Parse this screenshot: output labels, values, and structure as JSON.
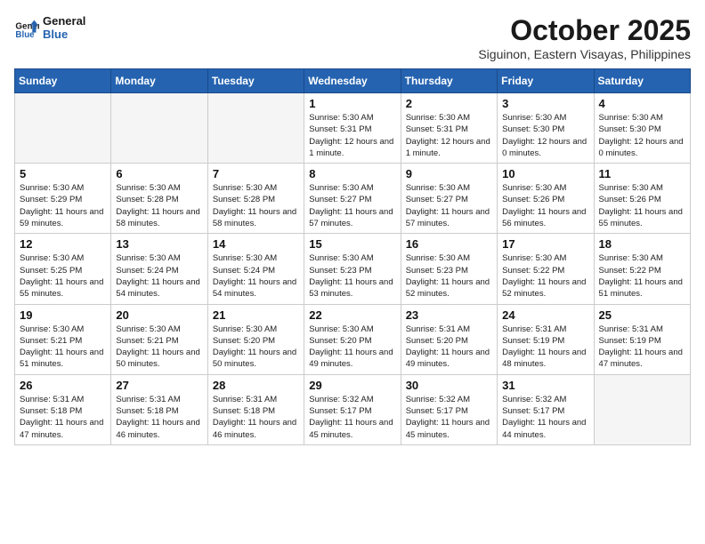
{
  "header": {
    "logo_line1": "General",
    "logo_line2": "Blue",
    "month": "October 2025",
    "location": "Siguinon, Eastern Visayas, Philippines"
  },
  "days_of_week": [
    "Sunday",
    "Monday",
    "Tuesday",
    "Wednesday",
    "Thursday",
    "Friday",
    "Saturday"
  ],
  "weeks": [
    [
      {
        "day": "",
        "empty": true
      },
      {
        "day": "",
        "empty": true
      },
      {
        "day": "",
        "empty": true
      },
      {
        "day": "1",
        "sunrise": "5:30 AM",
        "sunset": "5:31 PM",
        "daylight": "12 hours and 1 minute."
      },
      {
        "day": "2",
        "sunrise": "5:30 AM",
        "sunset": "5:31 PM",
        "daylight": "12 hours and 1 minute."
      },
      {
        "day": "3",
        "sunrise": "5:30 AM",
        "sunset": "5:30 PM",
        "daylight": "12 hours and 0 minutes."
      },
      {
        "day": "4",
        "sunrise": "5:30 AM",
        "sunset": "5:30 PM",
        "daylight": "12 hours and 0 minutes."
      }
    ],
    [
      {
        "day": "5",
        "sunrise": "5:30 AM",
        "sunset": "5:29 PM",
        "daylight": "11 hours and 59 minutes."
      },
      {
        "day": "6",
        "sunrise": "5:30 AM",
        "sunset": "5:28 PM",
        "daylight": "11 hours and 58 minutes."
      },
      {
        "day": "7",
        "sunrise": "5:30 AM",
        "sunset": "5:28 PM",
        "daylight": "11 hours and 58 minutes."
      },
      {
        "day": "8",
        "sunrise": "5:30 AM",
        "sunset": "5:27 PM",
        "daylight": "11 hours and 57 minutes."
      },
      {
        "day": "9",
        "sunrise": "5:30 AM",
        "sunset": "5:27 PM",
        "daylight": "11 hours and 57 minutes."
      },
      {
        "day": "10",
        "sunrise": "5:30 AM",
        "sunset": "5:26 PM",
        "daylight": "11 hours and 56 minutes."
      },
      {
        "day": "11",
        "sunrise": "5:30 AM",
        "sunset": "5:26 PM",
        "daylight": "11 hours and 55 minutes."
      }
    ],
    [
      {
        "day": "12",
        "sunrise": "5:30 AM",
        "sunset": "5:25 PM",
        "daylight": "11 hours and 55 minutes."
      },
      {
        "day": "13",
        "sunrise": "5:30 AM",
        "sunset": "5:24 PM",
        "daylight": "11 hours and 54 minutes."
      },
      {
        "day": "14",
        "sunrise": "5:30 AM",
        "sunset": "5:24 PM",
        "daylight": "11 hours and 54 minutes."
      },
      {
        "day": "15",
        "sunrise": "5:30 AM",
        "sunset": "5:23 PM",
        "daylight": "11 hours and 53 minutes."
      },
      {
        "day": "16",
        "sunrise": "5:30 AM",
        "sunset": "5:23 PM",
        "daylight": "11 hours and 52 minutes."
      },
      {
        "day": "17",
        "sunrise": "5:30 AM",
        "sunset": "5:22 PM",
        "daylight": "11 hours and 52 minutes."
      },
      {
        "day": "18",
        "sunrise": "5:30 AM",
        "sunset": "5:22 PM",
        "daylight": "11 hours and 51 minutes."
      }
    ],
    [
      {
        "day": "19",
        "sunrise": "5:30 AM",
        "sunset": "5:21 PM",
        "daylight": "11 hours and 51 minutes."
      },
      {
        "day": "20",
        "sunrise": "5:30 AM",
        "sunset": "5:21 PM",
        "daylight": "11 hours and 50 minutes."
      },
      {
        "day": "21",
        "sunrise": "5:30 AM",
        "sunset": "5:20 PM",
        "daylight": "11 hours and 50 minutes."
      },
      {
        "day": "22",
        "sunrise": "5:30 AM",
        "sunset": "5:20 PM",
        "daylight": "11 hours and 49 minutes."
      },
      {
        "day": "23",
        "sunrise": "5:31 AM",
        "sunset": "5:20 PM",
        "daylight": "11 hours and 49 minutes."
      },
      {
        "day": "24",
        "sunrise": "5:31 AM",
        "sunset": "5:19 PM",
        "daylight": "11 hours and 48 minutes."
      },
      {
        "day": "25",
        "sunrise": "5:31 AM",
        "sunset": "5:19 PM",
        "daylight": "11 hours and 47 minutes."
      }
    ],
    [
      {
        "day": "26",
        "sunrise": "5:31 AM",
        "sunset": "5:18 PM",
        "daylight": "11 hours and 47 minutes."
      },
      {
        "day": "27",
        "sunrise": "5:31 AM",
        "sunset": "5:18 PM",
        "daylight": "11 hours and 46 minutes."
      },
      {
        "day": "28",
        "sunrise": "5:31 AM",
        "sunset": "5:18 PM",
        "daylight": "11 hours and 46 minutes."
      },
      {
        "day": "29",
        "sunrise": "5:32 AM",
        "sunset": "5:17 PM",
        "daylight": "11 hours and 45 minutes."
      },
      {
        "day": "30",
        "sunrise": "5:32 AM",
        "sunset": "5:17 PM",
        "daylight": "11 hours and 45 minutes."
      },
      {
        "day": "31",
        "sunrise": "5:32 AM",
        "sunset": "5:17 PM",
        "daylight": "11 hours and 44 minutes."
      },
      {
        "day": "",
        "empty": true
      }
    ]
  ]
}
